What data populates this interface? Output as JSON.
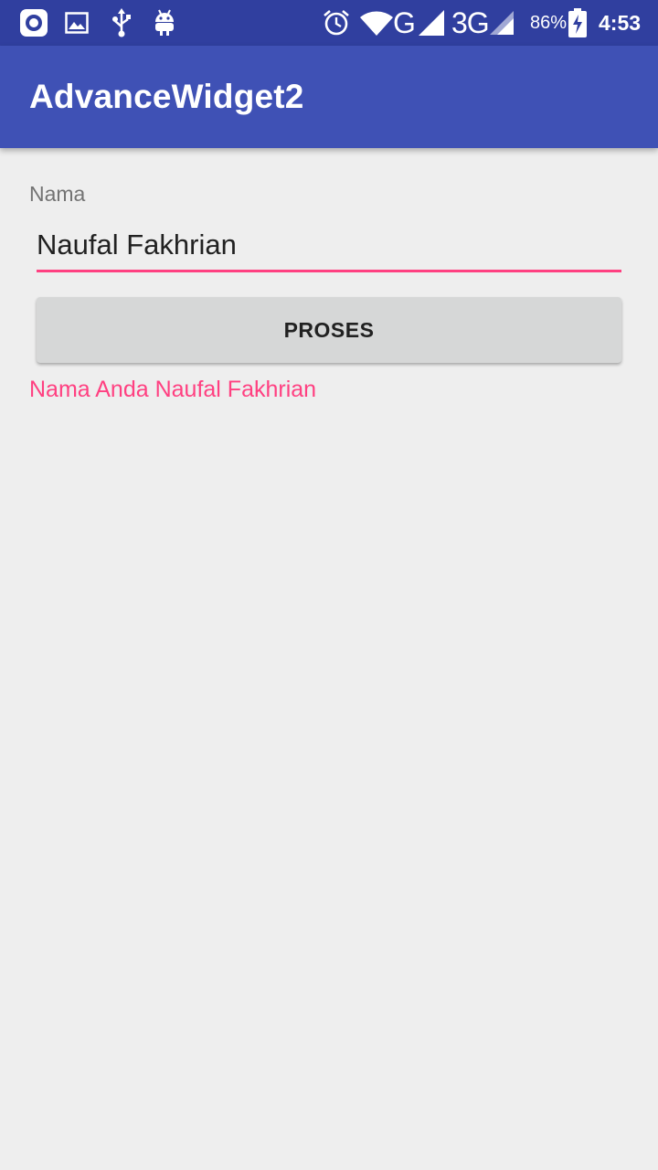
{
  "status_bar": {
    "icons_left": [
      "notification-app-icon",
      "image-icon",
      "usb-icon",
      "android-icon"
    ],
    "icons_right": [
      "alarm-icon",
      "wifi-icon",
      "signal-icon",
      "battery-charging-icon"
    ],
    "network_label_1": "G",
    "network_label_2": "3G",
    "battery": "86%",
    "time": "4:53",
    "colors": {
      "background": "#303f9f",
      "foreground": "#ffffff"
    }
  },
  "app_bar": {
    "title": "AdvanceWidget2",
    "color": "#3f51b5"
  },
  "form": {
    "label": "Nama",
    "input_value": "Naufal Fakhrian",
    "button_label": "PROSES",
    "result_text": "Nama Anda Naufal Fakhrian",
    "accent_color": "#ff4081"
  }
}
